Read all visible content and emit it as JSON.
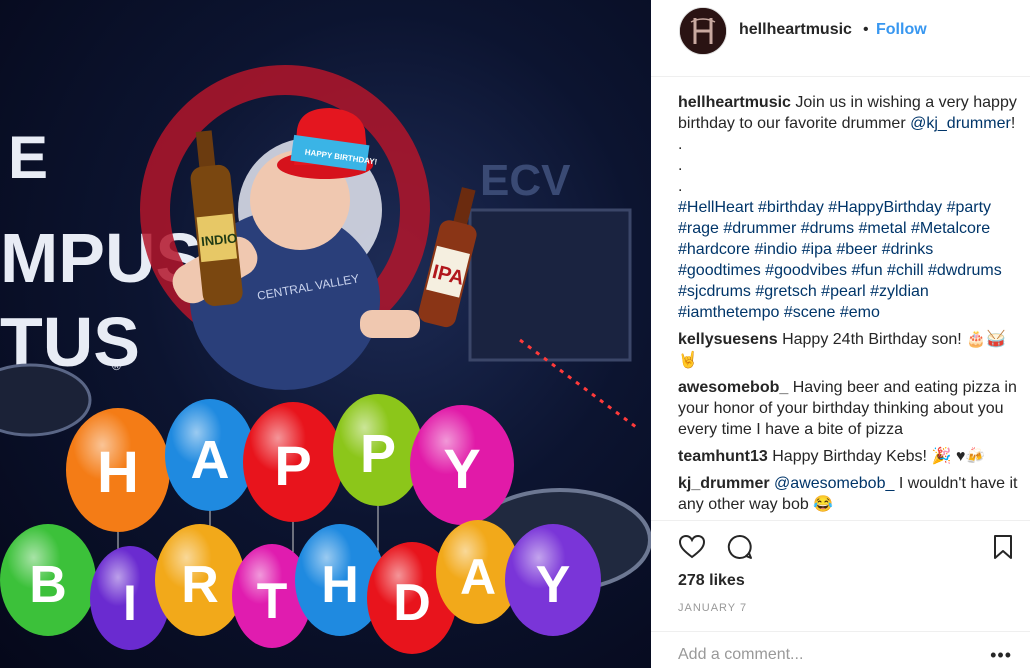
{
  "post": {
    "username": "hellheartmusic",
    "follow_label": "Follow",
    "separator": "•"
  },
  "image": {
    "wall_text_1": "E",
    "wall_text_2": "MPUS",
    "wall_text_3": "TUS",
    "wall_text_4": "ECV",
    "registered_mark": "®",
    "hat_text": "HAPPY BIRTHDAY!",
    "bottle_left_label": "INDIO",
    "bottle_right_label": "IPA",
    "shirt_text": "CENTRAL VALLEY",
    "balloons_row1": [
      "H",
      "A",
      "P",
      "P",
      "Y"
    ],
    "balloons_row2": [
      "B",
      "I",
      "R",
      "T",
      "H",
      "D",
      "A",
      "Y"
    ]
  },
  "caption": {
    "username": "hellheartmusic",
    "text": "Join us in wishing a very happy birthday to our favorite drummer",
    "mention": "@kj_drummer",
    "after_mention": "! .",
    "dot1": ".",
    "dot2": ".",
    "hashtags": "#HellHeart #birthday #HappyBirthday #party #rage #drummer #drums #metal #Metalcore #hardcore #indio #ipa #beer #drinks #goodtimes #goodvibes #fun #chill #dwdrums #sjcdrums #gretsch #pearl #zyldian #iamthetempo #scene #emo"
  },
  "comments": [
    {
      "username": "kellysuesens",
      "text": "Happy 24th Birthday son! 🎂🥁🤘"
    },
    {
      "username": "awesomebob_",
      "text": "Having beer and eating pizza in your honor of your birthday thinking about you every time I have a bite of pizza"
    },
    {
      "username": "teamhunt13",
      "text": "Happy Birthday Kebs! 🎉 ♥🍻"
    },
    {
      "username": "kj_drummer",
      "mention": "@awesomebob_",
      "text": "I wouldn't have it any other way bob 😂"
    }
  ],
  "actions": {
    "likes": "278 likes",
    "date": "JANUARY 7",
    "add_comment_placeholder": "Add a comment...",
    "more": "•••"
  },
  "icons": {
    "like": "heart-icon",
    "comment": "comment-bubble-icon",
    "save": "bookmark-icon",
    "more": "more-options-icon"
  },
  "colors": {
    "link_blue": "#3897f0",
    "hashtag_blue": "#003569",
    "text": "#262626",
    "muted": "#999999"
  }
}
